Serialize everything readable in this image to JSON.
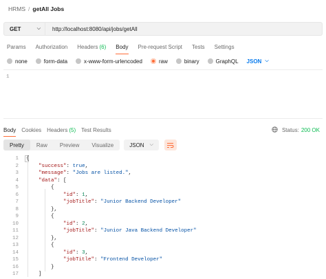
{
  "breadcrumb": {
    "parent": "HRMS",
    "separator": "/",
    "current": "getAll Jobs"
  },
  "request": {
    "method": "GET",
    "url": "http://localhost:8080/api/jobs/getAll",
    "tabs": [
      {
        "label": "Params",
        "count": ""
      },
      {
        "label": "Authorization",
        "count": ""
      },
      {
        "label": "Headers",
        "count": "(6)"
      },
      {
        "label": "Body",
        "count": ""
      },
      {
        "label": "Pre-request Script",
        "count": ""
      },
      {
        "label": "Tests",
        "count": ""
      },
      {
        "label": "Settings",
        "count": ""
      }
    ],
    "active_tab": "Body",
    "body_types": [
      "none",
      "form-data",
      "x-www-form-urlencoded",
      "raw",
      "binary",
      "GraphQL"
    ],
    "active_body_type": "raw",
    "format": "JSON",
    "editor_line": "1"
  },
  "response": {
    "tabs": [
      {
        "label": "Body",
        "count": ""
      },
      {
        "label": "Cookies",
        "count": ""
      },
      {
        "label": "Headers",
        "count": "(5)"
      },
      {
        "label": "Test Results",
        "count": ""
      }
    ],
    "status_label": "Status:",
    "status_value": "200 OK",
    "views": [
      "Pretty",
      "Raw",
      "Preview",
      "Visualize"
    ],
    "active_view": "Pretty",
    "format": "JSON",
    "lines": [
      {
        "n": "1",
        "text": "{"
      },
      {
        "n": "2",
        "text": "    \"success\": true,"
      },
      {
        "n": "3",
        "text": "    \"message\": \"Jobs are listed.\","
      },
      {
        "n": "4",
        "text": "    \"data\": ["
      },
      {
        "n": "5",
        "text": "        {"
      },
      {
        "n": "6",
        "text": "            \"id\": 1,"
      },
      {
        "n": "7",
        "text": "            \"jobTitle\": \"Junior Backend Developer\""
      },
      {
        "n": "8",
        "text": "        },"
      },
      {
        "n": "9",
        "text": "        {"
      },
      {
        "n": "10",
        "text": "            \"id\": 2,"
      },
      {
        "n": "11",
        "text": "            \"jobTitle\": \"Junior Java Backend Developer\""
      },
      {
        "n": "12",
        "text": "        },"
      },
      {
        "n": "13",
        "text": "        {"
      },
      {
        "n": "14",
        "text": "            \"id\": 3,"
      },
      {
        "n": "15",
        "text": "            \"jobTitle\": \"Frontend Developer\""
      },
      {
        "n": "16",
        "text": "        }"
      },
      {
        "n": "17",
        "text": "    ]"
      }
    ]
  },
  "colors": {
    "accent": "#ff6c37",
    "status_ok": "#0cbb52",
    "link": "#097bed"
  },
  "icons": {
    "globe": "globe-icon",
    "wrap": "wrap-lines-icon",
    "chevron": "chevron-down-icon"
  }
}
